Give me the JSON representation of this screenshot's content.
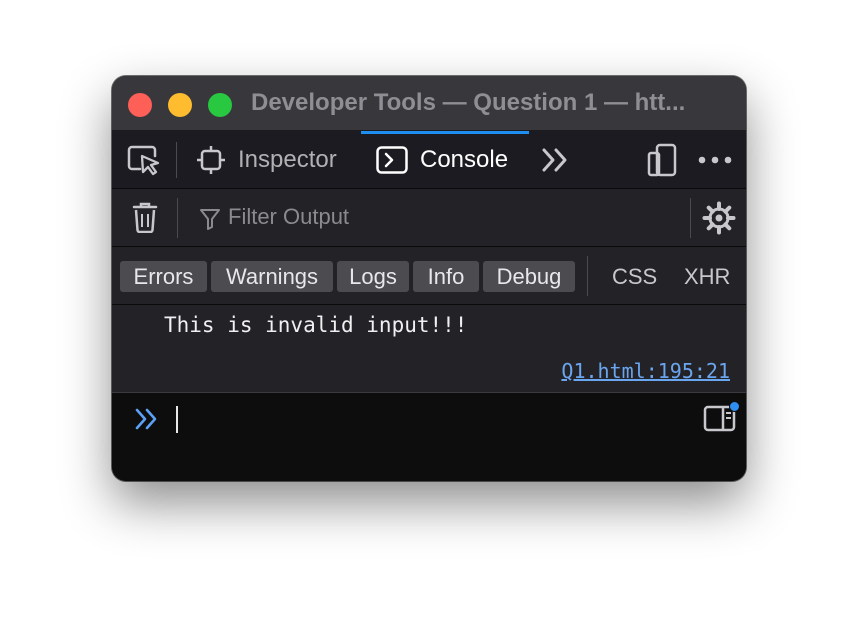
{
  "window": {
    "title": "Developer Tools — Question 1 — htt..."
  },
  "toolbar": {
    "tabs": [
      {
        "label": "Inspector",
        "icon": "inspector-icon",
        "active": false
      },
      {
        "label": "Console",
        "icon": "console-icon",
        "active": true
      }
    ],
    "icons": [
      "pick-element-icon",
      "more-tools-chevron-icon",
      "responsive-design-icon",
      "meatball-menu-icon"
    ]
  },
  "filter": {
    "placeholder": "Filter Output",
    "value": "",
    "icons": [
      "trash-icon",
      "filter-icon",
      "gear-icon"
    ]
  },
  "levels": {
    "toggles": [
      "Errors",
      "Warnings",
      "Logs",
      "Info",
      "Debug"
    ],
    "extra": [
      "CSS",
      "XHR"
    ]
  },
  "console": {
    "messages": [
      {
        "text": "This is invalid input!!!",
        "source": "Q1.html:195:21"
      }
    ]
  },
  "prompt": {
    "value": "",
    "icons": [
      "prompt-chevron-icon",
      "split-console-icon"
    ]
  },
  "colors": {
    "accent": "#1f8ef1",
    "close": "#fe5f57",
    "minimize": "#febc2e",
    "maximize": "#28c840",
    "link": "#6aa5f0"
  }
}
